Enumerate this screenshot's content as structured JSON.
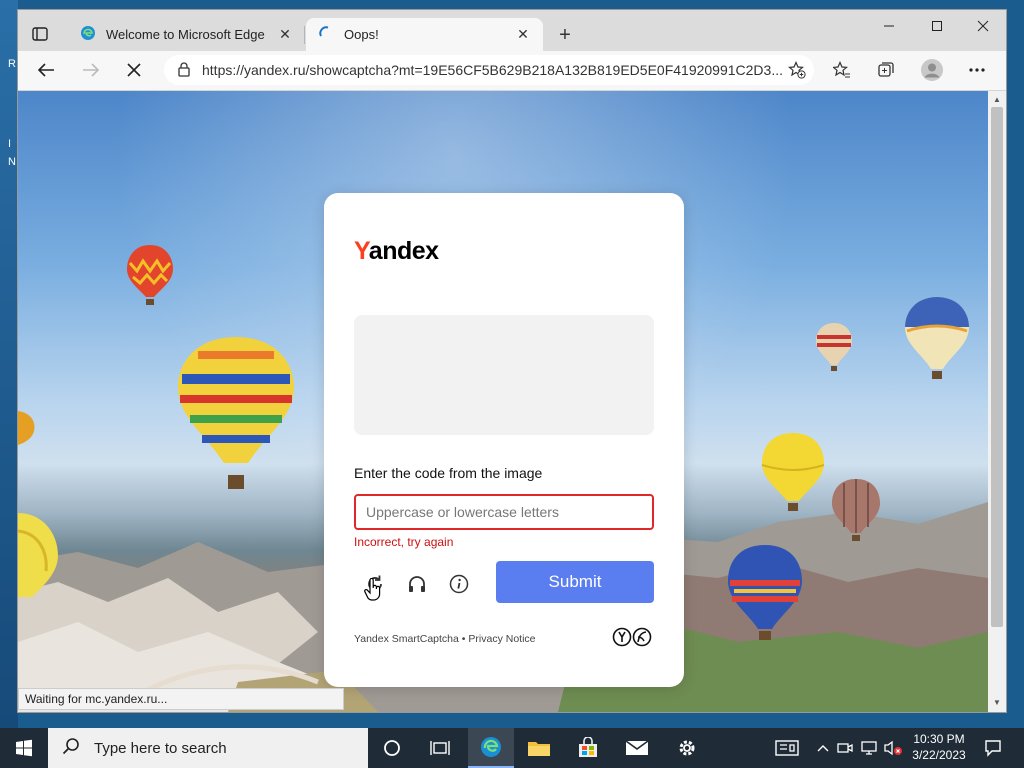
{
  "browser": {
    "tabs": [
      {
        "title": "Welcome to Microsoft Edge",
        "active": false
      },
      {
        "title": "Oops!",
        "active": true
      }
    ],
    "url": "https://yandex.ru/showcaptcha?mt=19E56CF5B629B218A132B819ED5E0F41920991C2D3...",
    "status": "Waiting for mc.yandex.ru..."
  },
  "captcha": {
    "logo_y": "Y",
    "logo_rest": "andex",
    "prompt": "Enter the code from the image",
    "input_placeholder": "Uppercase or lowercase letters",
    "input_value": "",
    "error": "Incorrect, try again",
    "submit_label": "Submit",
    "footer_links": {
      "smartcaptcha": "Yandex SmartCaptcha",
      "separator": "•",
      "privacy": "Privacy Notice"
    }
  },
  "taskbar": {
    "search_placeholder": "Type here to search",
    "time": "10:30 PM",
    "date": "3/22/2023"
  },
  "colors": {
    "brand_red": "#fc3f1d",
    "submit_blue": "#5a7ef0",
    "error_red": "#cc1111"
  }
}
